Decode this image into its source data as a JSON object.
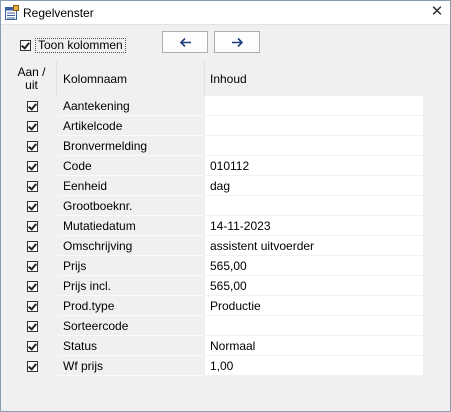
{
  "window": {
    "title": "Regelvenster"
  },
  "toolbar": {
    "show_columns_label": "Toon kolommen",
    "show_columns_checked": true
  },
  "grid": {
    "headers": {
      "toggle": "Aan /\nuit",
      "name": "Kolomnaam",
      "value": "Inhoud"
    },
    "rows": [
      {
        "checked": true,
        "name": "Aantekening",
        "value": ""
      },
      {
        "checked": true,
        "name": "Artikelcode",
        "value": ""
      },
      {
        "checked": true,
        "name": "Bronvermelding",
        "value": ""
      },
      {
        "checked": true,
        "name": "Code",
        "value": "010112"
      },
      {
        "checked": true,
        "name": "Eenheid",
        "value": "dag"
      },
      {
        "checked": true,
        "name": "Grootboeknr.",
        "value": ""
      },
      {
        "checked": true,
        "name": "Mutatiedatum",
        "value": "14-11-2023"
      },
      {
        "checked": true,
        "name": "Omschrijving",
        "value": "assistent uitvoerder"
      },
      {
        "checked": true,
        "name": "Prijs",
        "value": "565,00"
      },
      {
        "checked": true,
        "name": "Prijs incl.",
        "value": "565,00"
      },
      {
        "checked": true,
        "name": "Prod.type",
        "value": "Productie"
      },
      {
        "checked": true,
        "name": "Sorteercode",
        "value": ""
      },
      {
        "checked": true,
        "name": "Status",
        "value": "Normaal"
      },
      {
        "checked": true,
        "name": "Wf prijs",
        "value": "1,00"
      }
    ]
  },
  "icons": {
    "window": "grid-window-icon",
    "close": "close-icon",
    "prev": "arrow-left-icon",
    "next": "arrow-right-icon"
  }
}
